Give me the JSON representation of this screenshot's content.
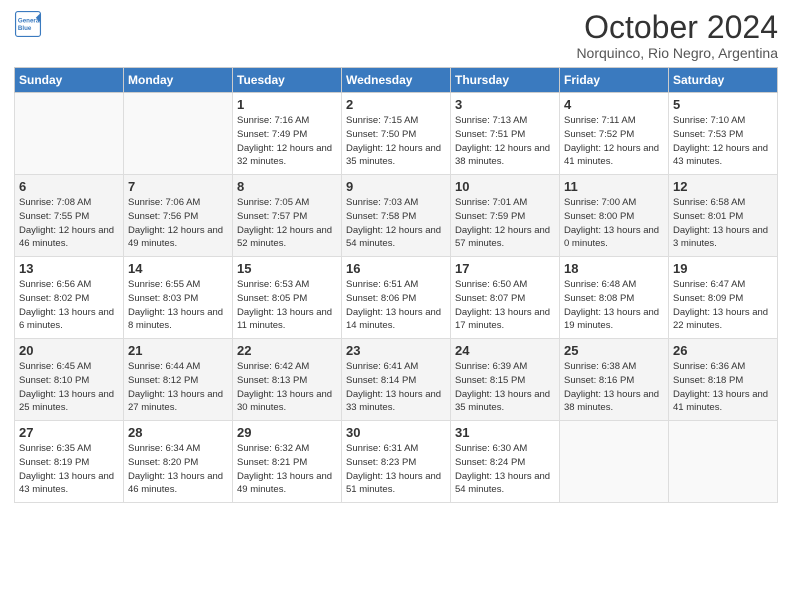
{
  "header": {
    "logo_line1": "General",
    "logo_line2": "Blue",
    "month": "October 2024",
    "location": "Norquinco, Rio Negro, Argentina"
  },
  "weekdays": [
    "Sunday",
    "Monday",
    "Tuesday",
    "Wednesday",
    "Thursday",
    "Friday",
    "Saturday"
  ],
  "weeks": [
    [
      {
        "day": "",
        "details": ""
      },
      {
        "day": "",
        "details": ""
      },
      {
        "day": "1",
        "details": "Sunrise: 7:16 AM\nSunset: 7:49 PM\nDaylight: 12 hours\nand 32 minutes."
      },
      {
        "day": "2",
        "details": "Sunrise: 7:15 AM\nSunset: 7:50 PM\nDaylight: 12 hours\nand 35 minutes."
      },
      {
        "day": "3",
        "details": "Sunrise: 7:13 AM\nSunset: 7:51 PM\nDaylight: 12 hours\nand 38 minutes."
      },
      {
        "day": "4",
        "details": "Sunrise: 7:11 AM\nSunset: 7:52 PM\nDaylight: 12 hours\nand 41 minutes."
      },
      {
        "day": "5",
        "details": "Sunrise: 7:10 AM\nSunset: 7:53 PM\nDaylight: 12 hours\nand 43 minutes."
      }
    ],
    [
      {
        "day": "6",
        "details": "Sunrise: 7:08 AM\nSunset: 7:55 PM\nDaylight: 12 hours\nand 46 minutes."
      },
      {
        "day": "7",
        "details": "Sunrise: 7:06 AM\nSunset: 7:56 PM\nDaylight: 12 hours\nand 49 minutes."
      },
      {
        "day": "8",
        "details": "Sunrise: 7:05 AM\nSunset: 7:57 PM\nDaylight: 12 hours\nand 52 minutes."
      },
      {
        "day": "9",
        "details": "Sunrise: 7:03 AM\nSunset: 7:58 PM\nDaylight: 12 hours\nand 54 minutes."
      },
      {
        "day": "10",
        "details": "Sunrise: 7:01 AM\nSunset: 7:59 PM\nDaylight: 12 hours\nand 57 minutes."
      },
      {
        "day": "11",
        "details": "Sunrise: 7:00 AM\nSunset: 8:00 PM\nDaylight: 13 hours\nand 0 minutes."
      },
      {
        "day": "12",
        "details": "Sunrise: 6:58 AM\nSunset: 8:01 PM\nDaylight: 13 hours\nand 3 minutes."
      }
    ],
    [
      {
        "day": "13",
        "details": "Sunrise: 6:56 AM\nSunset: 8:02 PM\nDaylight: 13 hours\nand 6 minutes."
      },
      {
        "day": "14",
        "details": "Sunrise: 6:55 AM\nSunset: 8:03 PM\nDaylight: 13 hours\nand 8 minutes."
      },
      {
        "day": "15",
        "details": "Sunrise: 6:53 AM\nSunset: 8:05 PM\nDaylight: 13 hours\nand 11 minutes."
      },
      {
        "day": "16",
        "details": "Sunrise: 6:51 AM\nSunset: 8:06 PM\nDaylight: 13 hours\nand 14 minutes."
      },
      {
        "day": "17",
        "details": "Sunrise: 6:50 AM\nSunset: 8:07 PM\nDaylight: 13 hours\nand 17 minutes."
      },
      {
        "day": "18",
        "details": "Sunrise: 6:48 AM\nSunset: 8:08 PM\nDaylight: 13 hours\nand 19 minutes."
      },
      {
        "day": "19",
        "details": "Sunrise: 6:47 AM\nSunset: 8:09 PM\nDaylight: 13 hours\nand 22 minutes."
      }
    ],
    [
      {
        "day": "20",
        "details": "Sunrise: 6:45 AM\nSunset: 8:10 PM\nDaylight: 13 hours\nand 25 minutes."
      },
      {
        "day": "21",
        "details": "Sunrise: 6:44 AM\nSunset: 8:12 PM\nDaylight: 13 hours\nand 27 minutes."
      },
      {
        "day": "22",
        "details": "Sunrise: 6:42 AM\nSunset: 8:13 PM\nDaylight: 13 hours\nand 30 minutes."
      },
      {
        "day": "23",
        "details": "Sunrise: 6:41 AM\nSunset: 8:14 PM\nDaylight: 13 hours\nand 33 minutes."
      },
      {
        "day": "24",
        "details": "Sunrise: 6:39 AM\nSunset: 8:15 PM\nDaylight: 13 hours\nand 35 minutes."
      },
      {
        "day": "25",
        "details": "Sunrise: 6:38 AM\nSunset: 8:16 PM\nDaylight: 13 hours\nand 38 minutes."
      },
      {
        "day": "26",
        "details": "Sunrise: 6:36 AM\nSunset: 8:18 PM\nDaylight: 13 hours\nand 41 minutes."
      }
    ],
    [
      {
        "day": "27",
        "details": "Sunrise: 6:35 AM\nSunset: 8:19 PM\nDaylight: 13 hours\nand 43 minutes."
      },
      {
        "day": "28",
        "details": "Sunrise: 6:34 AM\nSunset: 8:20 PM\nDaylight: 13 hours\nand 46 minutes."
      },
      {
        "day": "29",
        "details": "Sunrise: 6:32 AM\nSunset: 8:21 PM\nDaylight: 13 hours\nand 49 minutes."
      },
      {
        "day": "30",
        "details": "Sunrise: 6:31 AM\nSunset: 8:23 PM\nDaylight: 13 hours\nand 51 minutes."
      },
      {
        "day": "31",
        "details": "Sunrise: 6:30 AM\nSunset: 8:24 PM\nDaylight: 13 hours\nand 54 minutes."
      },
      {
        "day": "",
        "details": ""
      },
      {
        "day": "",
        "details": ""
      }
    ]
  ]
}
